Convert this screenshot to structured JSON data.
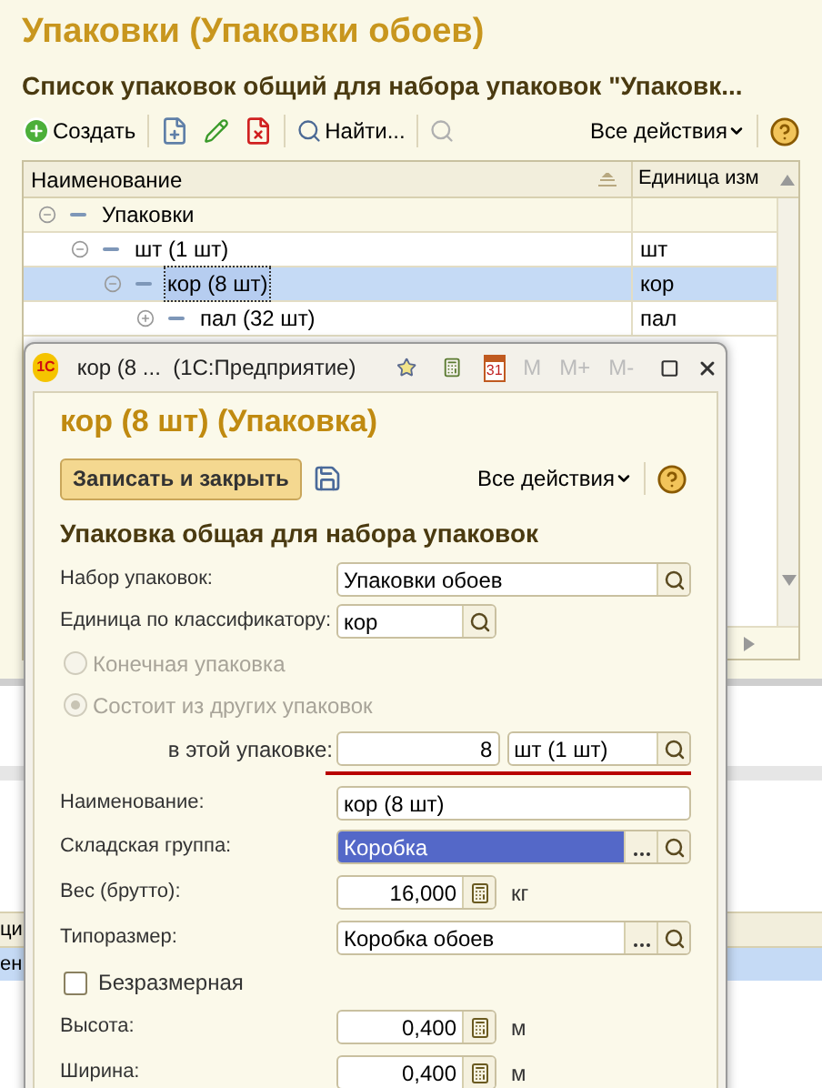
{
  "main": {
    "title": "Упаковки (Упаковки обоев)",
    "subtitle": "Список упаковок общий для набора упаковок \"Упаковк...",
    "toolbar": {
      "create": "Создать",
      "find": "Найти...",
      "all_actions": "Все действия"
    },
    "table": {
      "columns": [
        "Наименование",
        "Единица изм"
      ],
      "rows": [
        {
          "name": "Упаковки",
          "expanded": true,
          "selected": false,
          "children": [
            {
              "name": "шт (1 шт)",
              "unit": "шт",
              "expanded": true,
              "selected": false,
              "children": [
                {
                  "name": "кор (8 шт)",
                  "unit": "кор",
                  "expanded": true,
                  "selected": true,
                  "children": [
                    {
                      "name": "пал (32 шт)",
                      "unit": "пал",
                      "expanded": false,
                      "selected": false
                    }
                  ]
                }
              ]
            }
          ]
        }
      ]
    }
  },
  "lower_panel": {
    "column_header": "ци",
    "row": {
      "text": "ен",
      "selected": true
    }
  },
  "dialog": {
    "logo": "1С",
    "window_title": "кор (8 ...  (1С:Предприятие)",
    "calendar_day": "31",
    "memory_buttons": [
      "M",
      "M+",
      "M-"
    ],
    "title": "кор (8 шт) (Упаковка)",
    "save_close": "Записать и закрыть",
    "all_actions": "Все действия",
    "section": "Упаковка общая для набора упаковок",
    "fields": [
      {
        "kind": "ref",
        "label": "Набор упаковок:",
        "value": "Упаковки обоев"
      },
      {
        "kind": "code",
        "label": "Единица по классификатору:",
        "value": "кор"
      },
      {
        "kind": "radio",
        "label": "Конечная упаковка",
        "selected": false,
        "disabled": true
      },
      {
        "kind": "radio",
        "label": "Состоит из других упаковок",
        "selected": true,
        "disabled": true
      },
      {
        "kind": "quantity",
        "label": "в этой упаковке:",
        "value": "8",
        "unit_value": "шт (1 шт)"
      },
      {
        "kind": "text",
        "label": "Наименование:",
        "value": "кор (8 шт)"
      },
      {
        "kind": "choice",
        "label": "Складская группа:",
        "value": "Коробка",
        "highlighted": true
      },
      {
        "kind": "number",
        "label": "Вес (брутто):",
        "value": "16,000",
        "unit": "кг"
      },
      {
        "kind": "choice",
        "label": "Типоразмер:",
        "value": "Коробка обоев",
        "highlighted": false
      },
      {
        "kind": "checkbox",
        "label": "Безразмерная",
        "checked": false
      },
      {
        "kind": "number",
        "label": "Высота:",
        "value": "0,400",
        "unit": "м"
      },
      {
        "kind": "number",
        "label": "Ширина:",
        "value": "0,400",
        "unit": "м"
      }
    ]
  }
}
